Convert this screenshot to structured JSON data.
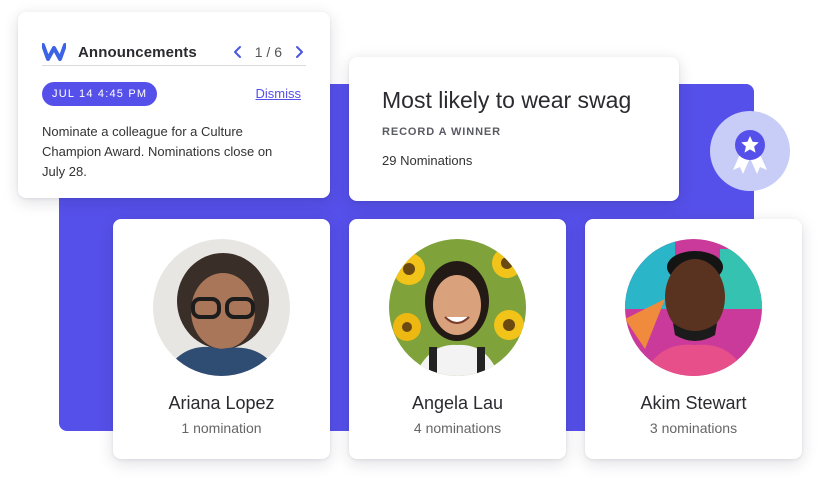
{
  "announcements": {
    "logo_icon": "workvivo-w-icon",
    "title": "Announcements",
    "pager": "1 / 6",
    "date": "JUL 14 4:45 PM",
    "dismiss": "Dismiss",
    "body": "Nominate a colleague for a Culture Champion Award. Nominations close on July 28."
  },
  "award": {
    "title": "Most likely to wear swag",
    "action": "RECORD A WINNER",
    "count": "29 Nominations",
    "badge_icon": "award-ribbon-icon"
  },
  "nominees": [
    {
      "name": "Ariana Lopez",
      "nominations": "1 nomination"
    },
    {
      "name": "Angela Lau",
      "nominations": "4 nominations"
    },
    {
      "name": "Akim Stewart",
      "nominations": "3 nominations"
    }
  ],
  "colors": {
    "accent": "#5650ea",
    "badge_bg": "#c8cdf7"
  }
}
